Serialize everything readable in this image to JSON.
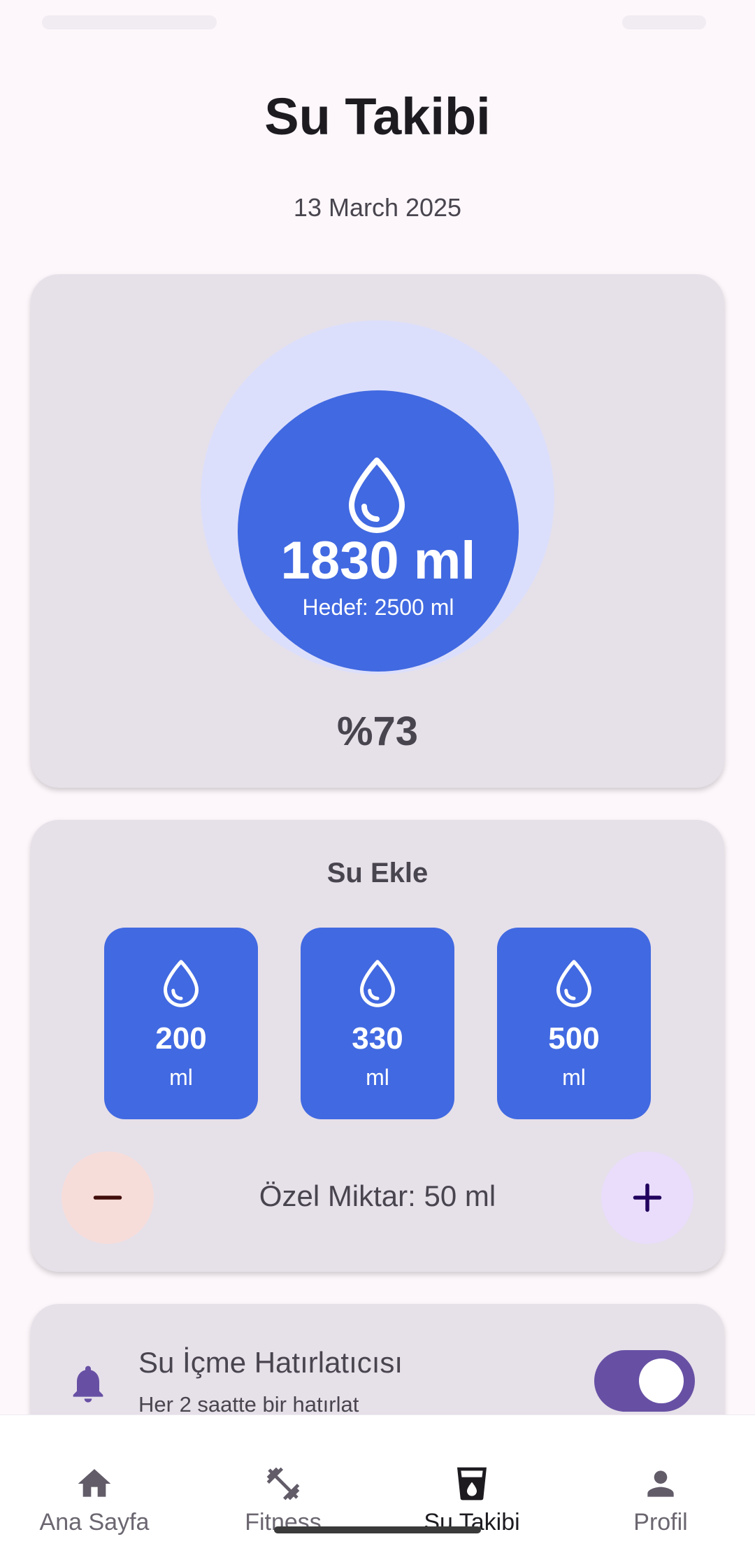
{
  "header": {
    "title": "Su Takibi",
    "date": "13 March 2025"
  },
  "progress": {
    "amount": "1830 ml",
    "goal": "Hedef: 2500 ml",
    "percent": "%73",
    "consumed_ml": 1830,
    "goal_ml": 2500
  },
  "add_water": {
    "title": "Su Ekle",
    "options": [
      {
        "value": "200",
        "unit": "ml"
      },
      {
        "value": "330",
        "unit": "ml"
      },
      {
        "value": "500",
        "unit": "ml"
      }
    ],
    "custom_label": "Özel Miktar: 50 ml"
  },
  "reminder": {
    "title": "Su İçme Hatırlatıcısı",
    "subtitle": "Her 2 saatte bir hatırlat",
    "enabled": true
  },
  "bottom_nav": {
    "items": [
      {
        "label": "Ana Sayfa",
        "icon": "home-icon"
      },
      {
        "label": "Fitness",
        "icon": "dumbbell-icon"
      },
      {
        "label": "Su Takibi",
        "icon": "water-glass-icon",
        "active": true
      },
      {
        "label": "Profil",
        "icon": "person-icon"
      }
    ]
  },
  "colors": {
    "primary_blue": "#4169e1",
    "accent_purple": "#6750a4",
    "card_bg": "#e6e0e9",
    "page_bg": "#fdf7fb"
  }
}
